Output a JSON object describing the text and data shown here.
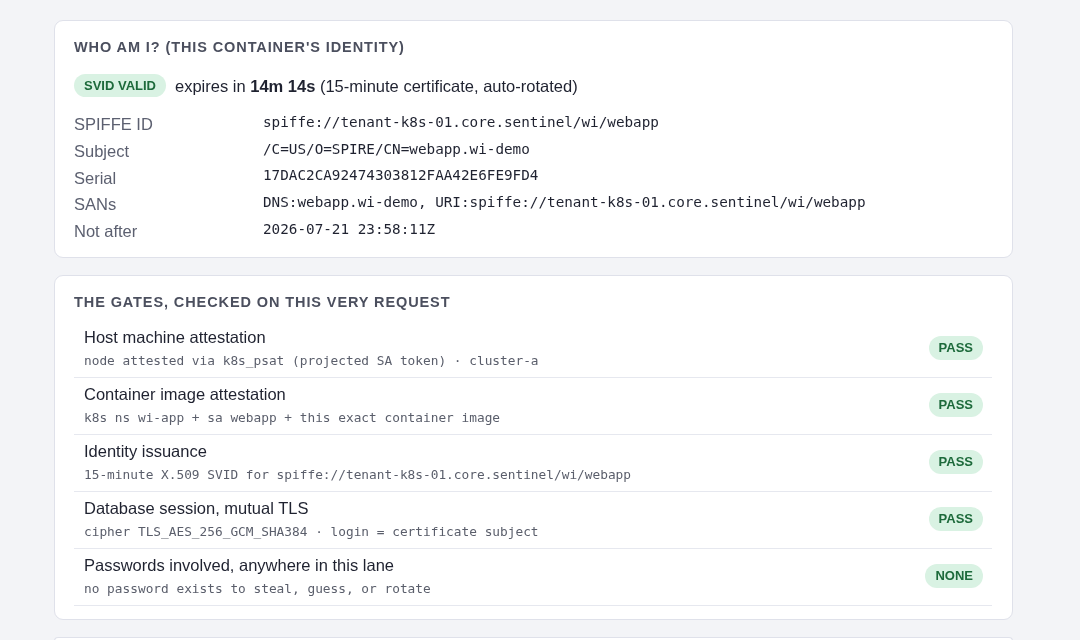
{
  "identity_card": {
    "title": "WHO AM I? (THIS CONTAINER'S IDENTITY)",
    "status_badge": "SVID VALID",
    "expiry_text": "expires in **14m 14s** (15-minute certificate, auto-rotated)",
    "fields": [
      {
        "label": "SPIFFE ID",
        "value": "spiffe://tenant-k8s-01.core.sentinel/wi/webapp"
      },
      {
        "label": "Subject",
        "value": "/C=US/O=SPIRE/CN=webapp.wi-demo"
      },
      {
        "label": "Serial",
        "value": "17DAC2CA92474303812FAA42E6FE9FD4"
      },
      {
        "label": "SANs",
        "value": "DNS:webapp.wi-demo, URI:spiffe://tenant-k8s-01.core.sentinel/wi/webapp"
      },
      {
        "label": "Not after",
        "value": "2026-07-21 23:58:11Z"
      }
    ]
  },
  "gates_card": {
    "title": "THE GATES, CHECKED ON THIS VERY REQUEST",
    "gates": [
      {
        "name": "Host machine attestation",
        "detail": "node attested via k8s_psat (projected SA token) · cluster-a",
        "status": "PASS"
      },
      {
        "name": "Container image attestation",
        "detail": "k8s ns wi-app + sa webapp + this exact container image",
        "status": "PASS"
      },
      {
        "name": "Identity issuance",
        "detail": "15-minute X.509 SVID for spiffe://tenant-k8s-01.core.sentinel/wi/webapp",
        "status": "PASS"
      },
      {
        "name": "Database session, mutual TLS",
        "detail": "cipher TLS_AES_256_GCM_SHA384 · login = certificate subject",
        "status": "PASS"
      },
      {
        "name": "Passwords involved, anywhere in this lane",
        "detail": "no password exists to steal, guess, or rotate",
        "status": "NONE"
      }
    ]
  }
}
